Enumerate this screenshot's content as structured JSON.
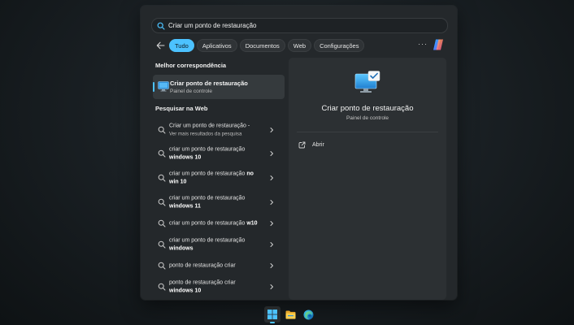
{
  "search": {
    "value": "Criar um ponto de restauração"
  },
  "tabs": [
    {
      "label": "Tudo",
      "active": true
    },
    {
      "label": "Aplicativos"
    },
    {
      "label": "Documentos"
    },
    {
      "label": "Web"
    },
    {
      "label": "Configurações"
    }
  ],
  "more_label": "···",
  "best_match": {
    "section_title": "Melhor correspondência",
    "title": "Criar ponto de restauração",
    "subtitle": "Painel de controle"
  },
  "web": {
    "section_title": "Pesquisar na Web",
    "items": [
      {
        "normal": "Criar um ponto de restauração -",
        "bold": "",
        "sub": "Ver mais resultados da pesquisa"
      },
      {
        "normal": "criar um ponto de restauração",
        "bold": "windows 10",
        "sub": ""
      },
      {
        "normal": "criar um ponto de restauração",
        "bold": "no win 10",
        "sub": ""
      },
      {
        "normal": "criar um ponto de restauração",
        "bold": "windows 11",
        "sub": ""
      },
      {
        "normal": "criar um ponto de restauração",
        "bold": "w10",
        "sub": ""
      },
      {
        "normal": "criar um ponto de restauração",
        "bold": "windows",
        "sub": ""
      },
      {
        "normal": "ponto de restauração criar",
        "bold": "",
        "sub": ""
      },
      {
        "normal": "ponto de restauração criar",
        "bold": "windows 10",
        "sub": ""
      }
    ]
  },
  "detail": {
    "title": "Criar ponto de restauração",
    "subtitle": "Painel de controle",
    "open_label": "Abrir"
  },
  "taskbar": {
    "items": [
      {
        "name": "start-icon",
        "active": true
      },
      {
        "name": "file-explorer-icon"
      },
      {
        "name": "edge-icon"
      }
    ]
  },
  "colors": {
    "accent": "#4cc2ff",
    "panel": "#24282b",
    "detail_panel": "#2c3033"
  }
}
